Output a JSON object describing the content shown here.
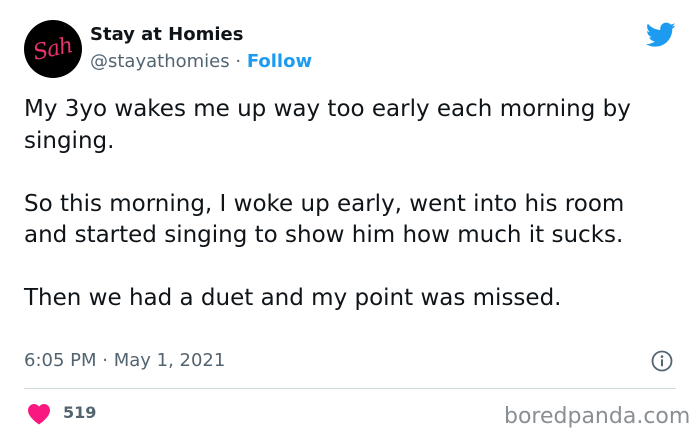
{
  "author": {
    "avatar_text": "Sah",
    "display_name": "Stay at Homies",
    "handle": "@stayathomies",
    "separator": "·",
    "follow_label": "Follow"
  },
  "tweet": {
    "paragraphs": [
      "My 3yo wakes me up way too early each morning by singing.",
      "So this morning, I woke up early, went into his room and started singing to show him how much it sucks.",
      "Then we had a duet and my point was missed."
    ],
    "timestamp": "6:05 PM · May 1, 2021"
  },
  "engagement": {
    "likes": "519"
  },
  "icons": {
    "platform": "twitter-bird-icon",
    "info": "info-icon",
    "like": "heart-icon"
  },
  "colors": {
    "accent": "#1d9bf0",
    "heart": "#f91880",
    "avatar_bg": "#000000",
    "avatar_text": "#e5336a",
    "secondary_text": "#536471"
  },
  "watermark": "boredpanda.com"
}
